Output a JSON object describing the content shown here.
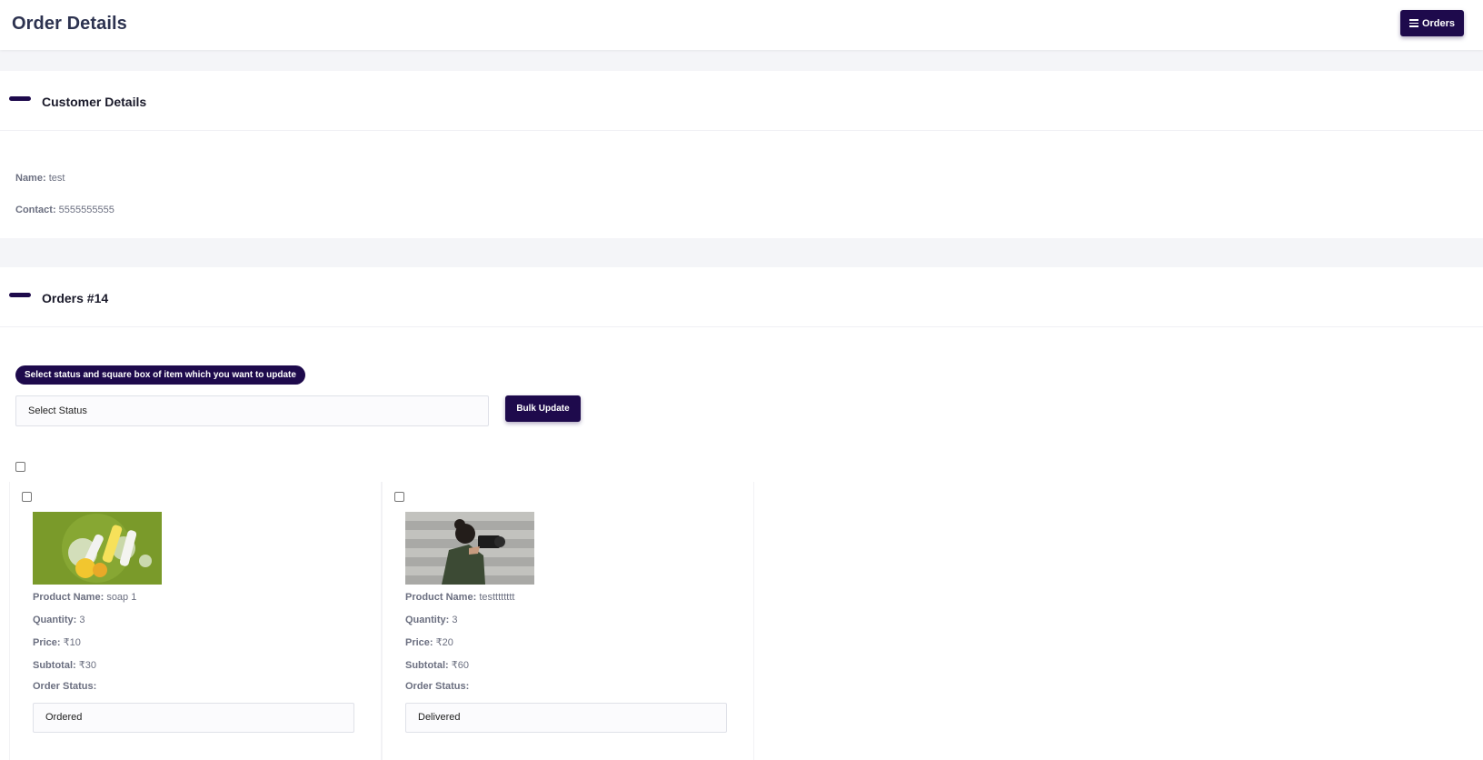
{
  "header": {
    "title": "Order Details",
    "orders_button": "Orders"
  },
  "customer": {
    "section_title": "Customer Details",
    "name_label": "Name:",
    "name_value": "test",
    "contact_label": "Contact:",
    "contact_value": "5555555555"
  },
  "orders": {
    "section_title": "Orders #14",
    "hint": "Select status and square box of item which you want to update",
    "status_select": "Select Status",
    "bulk_update_button": "Bulk Update",
    "labels": {
      "product_name": "Product Name:",
      "quantity": "Quantity:",
      "price": "Price:",
      "subtotal": "Subtotal:",
      "order_status": "Order Status:"
    },
    "items": [
      {
        "product_name": "soap 1",
        "quantity": "3",
        "price": "₹10",
        "subtotal": "₹30",
        "status": "Ordered"
      },
      {
        "product_name": "testttttttt",
        "quantity": "3",
        "price": "₹20",
        "subtotal": "₹60",
        "status": "Delivered"
      }
    ]
  },
  "colors": {
    "brand": "#1e0a4c",
    "background": "#f4f5f8",
    "card": "#ffffff",
    "label_text": "#6b6f80"
  },
  "icons": {
    "orders_button": "list-icon",
    "section_marker": "dash-icon"
  }
}
